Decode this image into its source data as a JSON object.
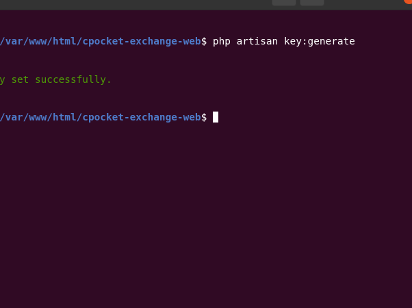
{
  "terminal": {
    "lines": [
      {
        "path": "/var/www/html/cpocket-exchange-web",
        "prompt_symbol": "$",
        "command": " php artisan key:generate"
      },
      {
        "output": "y set successfully."
      },
      {
        "path": "/var/www/html/cpocket-exchange-web",
        "prompt_symbol": "$",
        "command": " "
      }
    ]
  },
  "colors": {
    "background": "#300a24",
    "path": "#4e7bc9",
    "success_output": "#4e9a06",
    "text": "#ffffff",
    "titlebar": "#333333",
    "close_accent": "#e95420"
  }
}
